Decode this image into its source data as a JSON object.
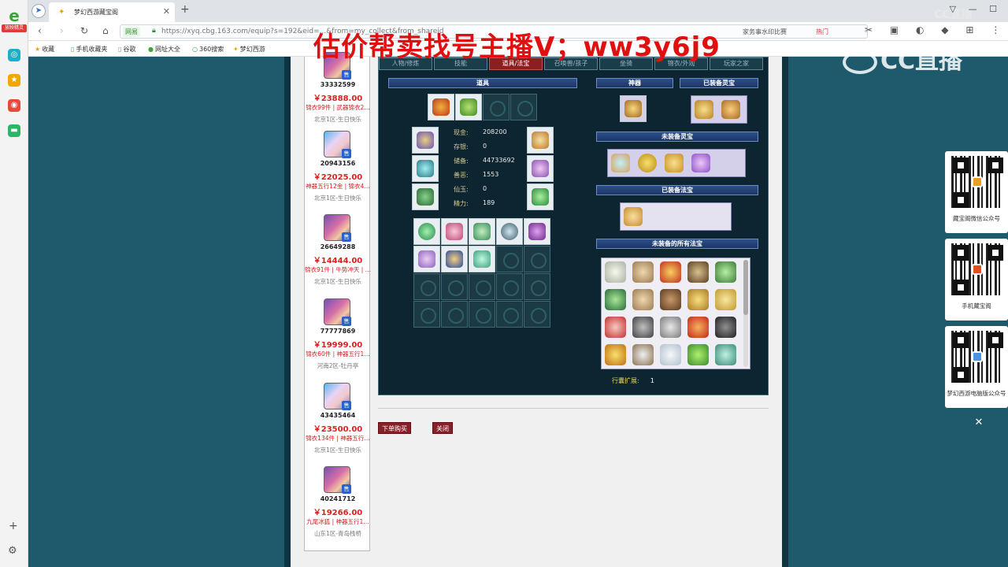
{
  "browser": {
    "sidebar_label": "放映精灵",
    "tab_title": "梦幻西游藏宝阁",
    "address": {
      "badge": "网易",
      "url": "https://xyq.cbg.163.com/equip?s=192&eid=...&from=my_collect&from_shareid",
      "url_host": "xyq.cbg.163.com",
      "suggest": "家务事水印比赛",
      "hot": "热门"
    },
    "bookmarks": [
      {
        "label": "收藏"
      },
      {
        "label": "手机收藏夹"
      },
      {
        "label": "谷歌"
      },
      {
        "label": "网址大全"
      },
      {
        "label": "360搜索"
      },
      {
        "label": "梦幻西游"
      }
    ],
    "cc_brand": "CC直播"
  },
  "watermark": "估价帮卖找号主播V；ww3y6j9",
  "listings": [
    {
      "id": "33332599",
      "price": "￥23888.00",
      "desc": "锦衣99件 | 武器锦衣2…",
      "server": "北京1区-生日快乐",
      "avatar": "purple"
    },
    {
      "id": "20943156",
      "price": "￥22025.00",
      "desc": "神器五行12金 | 锦衣4…",
      "server": "北京1区-生日快乐",
      "avatar": "blue"
    },
    {
      "id": "26649288",
      "price": "￥14444.00",
      "desc": "锦衣91件 | 牛势冲天 | …",
      "server": "北京1区-生日快乐",
      "avatar": "purple"
    },
    {
      "id": "77777869",
      "price": "￥19999.00",
      "desc": "锦衣60件 | 神器五行1…",
      "server": "河南2区-牡丹亭",
      "avatar": "purple"
    },
    {
      "id": "43435464",
      "price": "￥23500.00",
      "desc": "锦衣134件 | 神器五行…",
      "server": "北京1区-生日快乐",
      "avatar": "blue"
    },
    {
      "id": "40241712",
      "price": "￥19266.00",
      "desc": "九尾冰狐 | 神器五行1…",
      "server": "山东1区-青岛栈桥",
      "avatar": "purple"
    }
  ],
  "subtabs": [
    "人物/修炼",
    "技能",
    "道具/法宝",
    "召唤兽/孩子",
    "坐骑",
    "锦衣/外观",
    "玩家之家"
  ],
  "active_subtab": 2,
  "sections": {
    "items": "道具",
    "artifact": "神器",
    "equipped_lingbao": "已装备灵宝",
    "unequipped_lingbao": "未装备灵宝",
    "equipped_fabao": "已装备法宝",
    "all_unequipped_fabao": "未装备的所有法宝"
  },
  "stats": [
    {
      "label": "现金:",
      "value": "208200"
    },
    {
      "label": "存银:",
      "value": "0"
    },
    {
      "label": "储备:",
      "value": "44733692"
    },
    {
      "label": "善恶:",
      "value": "1553"
    },
    {
      "label": "仙玉:",
      "value": "0"
    },
    {
      "label": "精力:",
      "value": "189"
    }
  ],
  "bag_expansion": {
    "label": "行囊扩展:",
    "value": "1"
  },
  "buttons": {
    "buy": "下单购买",
    "close": "关闭"
  },
  "qr_cards": [
    {
      "label": "藏宝阁微信公众号"
    },
    {
      "label": "手机藏宝阁"
    },
    {
      "label": "梦幻西游电脑版公众号"
    }
  ],
  "colors": {
    "page_bg": "#1e5a6b",
    "panel_bg": "#0c2530",
    "active_tab": "#8a1f1f",
    "price": "#e02020",
    "watermark": "#e01010"
  }
}
